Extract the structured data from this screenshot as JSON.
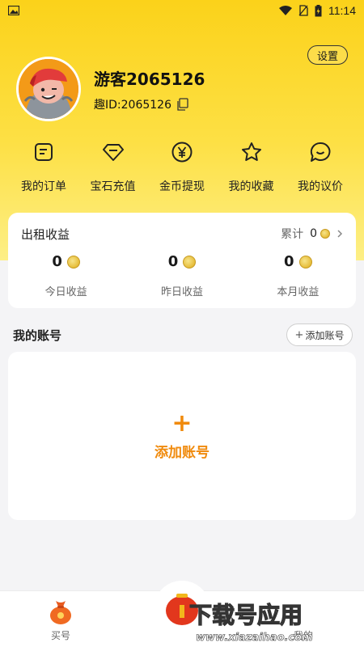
{
  "status_bar": {
    "time": "11:14"
  },
  "profile": {
    "settings_label": "设置",
    "username": "游客2065126",
    "user_id": "趣ID:2065126"
  },
  "quick_menu": [
    {
      "label": "我的订单",
      "icon": "order-icon"
    },
    {
      "label": "宝石充值",
      "icon": "gem-icon"
    },
    {
      "label": "金币提现",
      "icon": "yen-icon"
    },
    {
      "label": "我的收藏",
      "icon": "star-icon"
    },
    {
      "label": "我的议价",
      "icon": "chat-icon"
    }
  ],
  "rent_income": {
    "title": "出租收益",
    "total_label": "累计",
    "total_value": "0",
    "stats": [
      {
        "value": "0",
        "label": "今日收益"
      },
      {
        "value": "0",
        "label": "昨日收益"
      },
      {
        "value": "0",
        "label": "本月收益"
      }
    ]
  },
  "accounts": {
    "header": "我的账号",
    "add_pill_label": "添加账号",
    "add_big_label": "添加账号"
  },
  "tab_bar": {
    "tabs": [
      {
        "label": "买号"
      },
      {
        "label": ""
      },
      {
        "label": "我的"
      }
    ]
  },
  "watermark": {
    "text": "下载号应用",
    "url": "www.xiazaihao.com"
  },
  "colors": {
    "accent": "#f08a0c",
    "yellow": "#fbd21a"
  }
}
